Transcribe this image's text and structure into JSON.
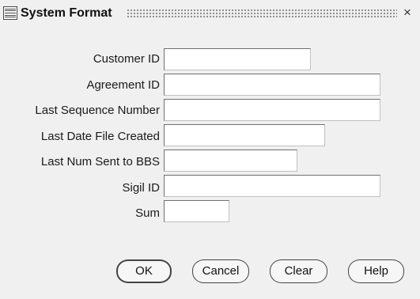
{
  "window": {
    "title": "System Format",
    "close_glyph": "×"
  },
  "icons": {
    "app": "oracle-form-icon",
    "close": "close-icon",
    "grip": "title-grip-pattern"
  },
  "fields": [
    {
      "label": "Customer ID",
      "value": ""
    },
    {
      "label": "Agreement ID",
      "value": ""
    },
    {
      "label": "Last Sequence Number",
      "value": ""
    },
    {
      "label": "Last Date File Created",
      "value": ""
    },
    {
      "label": "Last Num Sent to BBS",
      "value": ""
    },
    {
      "label": "Sigil ID",
      "value": ""
    },
    {
      "label": "Sum",
      "value": ""
    }
  ],
  "buttons": {
    "ok": "OK",
    "cancel": "Cancel",
    "clear": "Clear",
    "help": "Help"
  }
}
